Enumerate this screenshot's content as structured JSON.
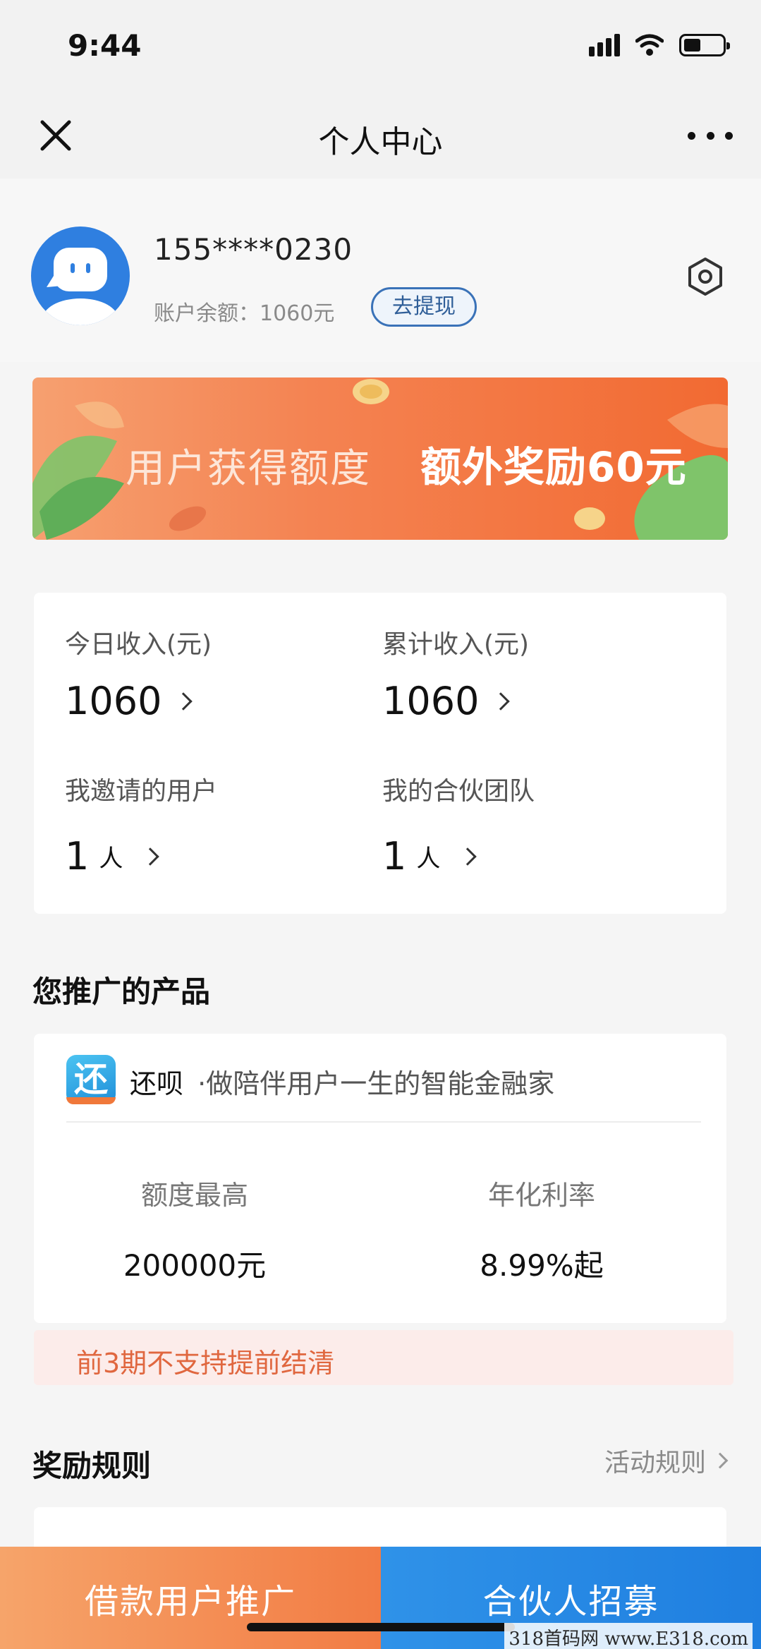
{
  "status_bar": {
    "time": "9:44"
  },
  "nav": {
    "title": "个人中心"
  },
  "profile": {
    "phone": "155****0230",
    "balance_label": "账户余额：",
    "balance_value": "1060元",
    "withdraw_label": "去提现"
  },
  "banner": {
    "text_primary": "用户获得额度",
    "text_bonus": "额外奖励60元"
  },
  "stats": {
    "today_income": {
      "label": "今日收入(元)",
      "value": "1060"
    },
    "total_income": {
      "label": "累计收入(元)",
      "value": "1060"
    },
    "invited_users": {
      "label": "我邀请的用户",
      "value": "1",
      "unit": "人"
    },
    "partner_team": {
      "label": "我的合伙团队",
      "value": "1",
      "unit": "人"
    }
  },
  "promoted_section": {
    "title": "您推广的产品"
  },
  "product": {
    "logo_char": "还",
    "name": "还呗",
    "slogan": "·做陪伴用户一生的智能金融家",
    "metrics": [
      {
        "label": "额度最高",
        "value": "200000元"
      },
      {
        "label": "年化利率",
        "value": "8.99%起"
      }
    ],
    "notice": "前3期不支持提前结清"
  },
  "rules_section": {
    "title": "奖励规则",
    "link_label": "活动规则"
  },
  "bottom_bar": {
    "left_label": "借款用户推广",
    "right_label": "合伙人招募"
  },
  "watermark": "318首码网 www.E318.com",
  "colors": {
    "primary_blue": "#1f7fe0",
    "accent_orange": "#f27c44",
    "notice_red": "#e0673f"
  }
}
